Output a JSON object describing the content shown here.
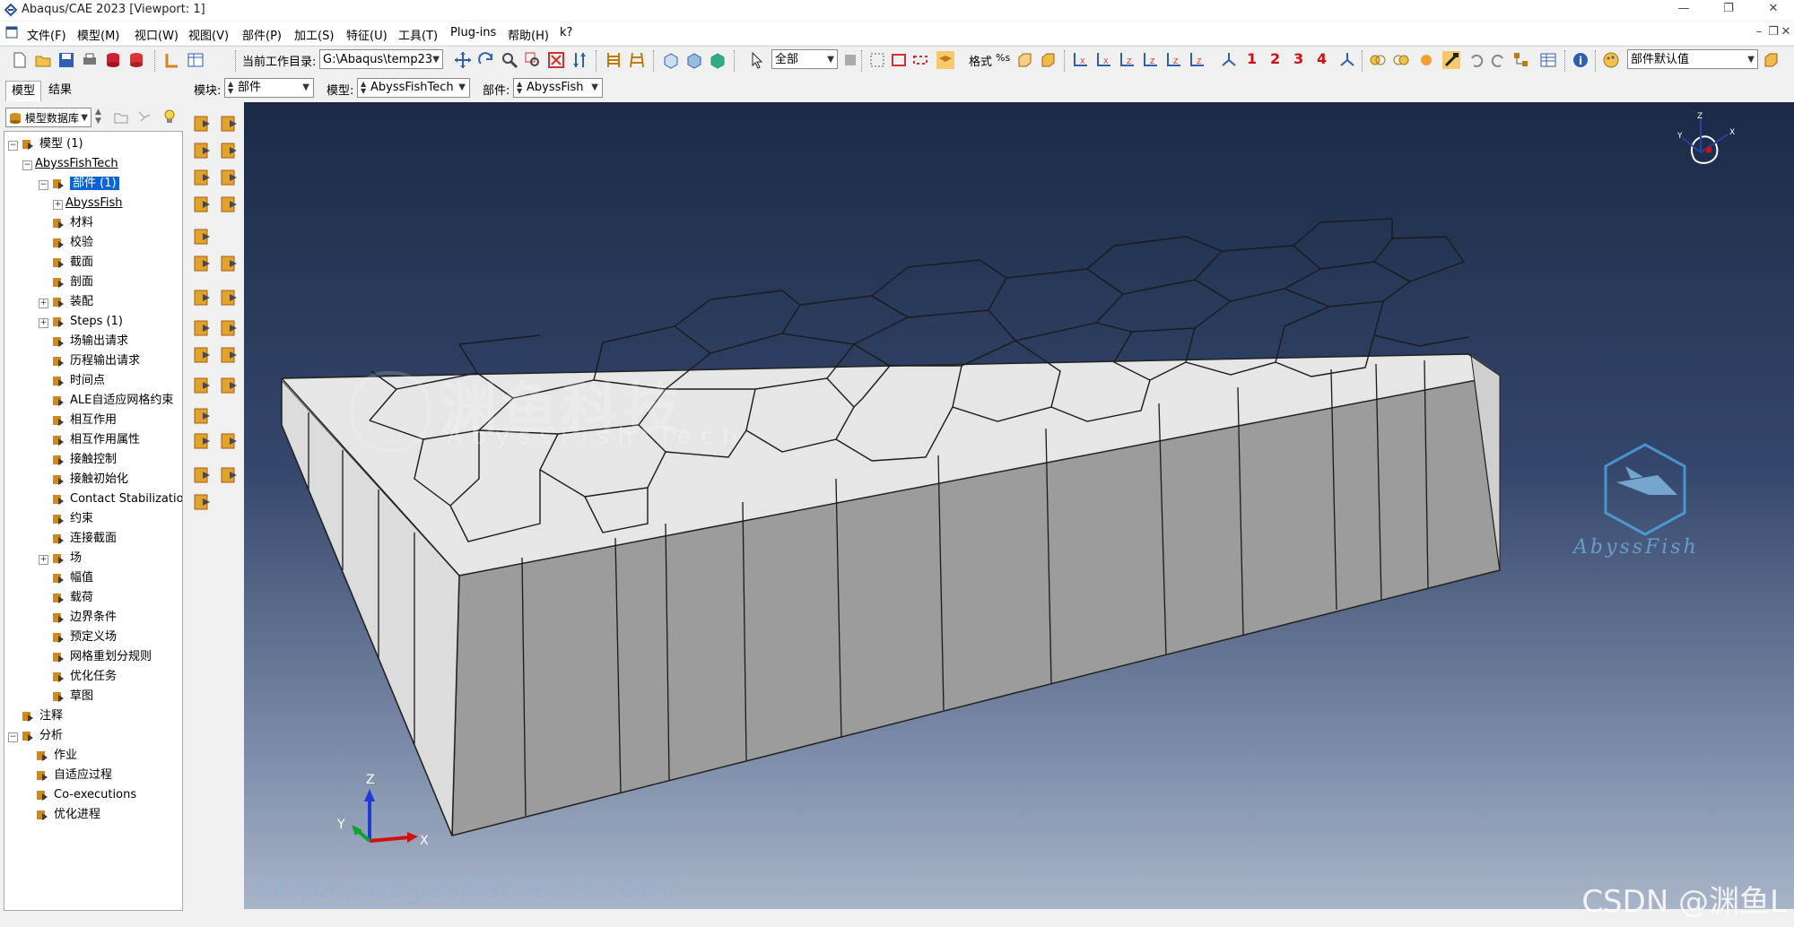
{
  "window": {
    "title": "Abaqus/CAE 2023 [Viewport: 1]"
  },
  "menubar": [
    "文件(F)",
    "模型(M)",
    "视口(W)",
    "视图(V)",
    "部件(P)",
    "加工(S)",
    "特征(U)",
    "工具(T)",
    "Plug-ins",
    "帮助(H)",
    "k?"
  ],
  "toolbar": {
    "workdir_label": "当前工作目录:",
    "workdir_value": "G:\\Abaqus\\temp23",
    "select_filter": "全部",
    "format_label": "格式",
    "datum_numbers": [
      "1",
      "2",
      "3",
      "4"
    ],
    "part_defaults": "部件默认值"
  },
  "context": {
    "module_label": "模块:",
    "module_value": "部件",
    "model_label": "模型:",
    "model_value": "AbyssFishTech",
    "part_label": "部件:",
    "part_value": "AbyssFish"
  },
  "tabs": [
    "模型",
    "结果"
  ],
  "tree": {
    "filter": "模型数据库",
    "items": [
      {
        "label": "模型 (1)",
        "icon": "model-db-icon",
        "level": 0,
        "exp": "-"
      },
      {
        "label": "AbyssFishTech",
        "icon": "",
        "level": 1,
        "exp": "-",
        "underline": true
      },
      {
        "label": "部件 (1)",
        "icon": "part-icon",
        "level": 2,
        "exp": "-",
        "selected": true
      },
      {
        "label": "AbyssFish",
        "icon": "",
        "level": 3,
        "exp": "+",
        "underline": true
      },
      {
        "label": "材料",
        "icon": "material-icon",
        "level": 2
      },
      {
        "label": "校验",
        "icon": "calibration-icon",
        "level": 2
      },
      {
        "label": "截面",
        "icon": "section-icon",
        "level": 2
      },
      {
        "label": "剖面",
        "icon": "profile-icon",
        "level": 2
      },
      {
        "label": "装配",
        "icon": "assembly-icon",
        "level": 2,
        "exp": "+"
      },
      {
        "label": "Steps (1)",
        "icon": "steps-icon",
        "level": 2,
        "exp": "+"
      },
      {
        "label": "场输出请求",
        "icon": "field-output-icon",
        "level": 2
      },
      {
        "label": "历程输出请求",
        "icon": "history-output-icon",
        "level": 2
      },
      {
        "label": "时间点",
        "icon": "time-points-icon",
        "level": 2
      },
      {
        "label": "ALE自适应网格约束",
        "icon": "ale-icon",
        "level": 2
      },
      {
        "label": "相互作用",
        "icon": "interaction-icon",
        "level": 2
      },
      {
        "label": "相互作用属性",
        "icon": "interaction-property-icon",
        "level": 2
      },
      {
        "label": "接触控制",
        "icon": "contact-control-icon",
        "level": 2
      },
      {
        "label": "接触初始化",
        "icon": "contact-init-icon",
        "level": 2
      },
      {
        "label": "Contact Stabilizations",
        "icon": "contact-stab-icon",
        "level": 2
      },
      {
        "label": "约束",
        "icon": "constraint-icon",
        "level": 2
      },
      {
        "label": "连接截面",
        "icon": "connector-section-icon",
        "level": 2
      },
      {
        "label": "场",
        "icon": "field-icon",
        "level": 2,
        "exp": "+"
      },
      {
        "label": "幅值",
        "icon": "amplitude-icon",
        "level": 2
      },
      {
        "label": "载荷",
        "icon": "load-icon",
        "level": 2
      },
      {
        "label": "边界条件",
        "icon": "bc-icon",
        "level": 2
      },
      {
        "label": "预定义场",
        "icon": "predefined-field-icon",
        "level": 2
      },
      {
        "label": "网格重划分规则",
        "icon": "remesh-icon",
        "level": 2
      },
      {
        "label": "优化任务",
        "icon": "optimization-icon",
        "level": 2
      },
      {
        "label": "草图",
        "icon": "sketch-icon",
        "level": 2
      },
      {
        "label": "注释",
        "icon": "annotation-icon",
        "level": 0,
        "exp": ""
      },
      {
        "label": "分析",
        "icon": "analysis-icon",
        "level": 0,
        "exp": "-"
      },
      {
        "label": "作业",
        "icon": "job-icon",
        "level": 1
      },
      {
        "label": "自适应过程",
        "icon": "adaptivity-icon",
        "level": 1
      },
      {
        "label": "Co-executions",
        "icon": "coexec-icon",
        "level": 1
      },
      {
        "label": "优化进程",
        "icon": "opt-process-icon",
        "level": 1
      }
    ]
  },
  "viewport": {
    "triad": {
      "x": "X",
      "y": "Y",
      "z": "Z"
    },
    "mini_triad": {
      "x": "X",
      "y": "Y",
      "z": "Z"
    }
  },
  "watermarks": {
    "cn": "渊鱼科技",
    "en": "AbyssFish Tech",
    "fish": "AbyssFish",
    "url": "https://abyssfishtech.com/",
    "csdn": "CSDN @渊鱼L"
  },
  "colors": {
    "viewport_top": "#1b2a46",
    "viewport_bottom": "#a8b4c8",
    "selection": "#0a64d8",
    "part_top": "#e4e4e4",
    "part_front": "#9c9c9c",
    "part_side": "#dcdcdc"
  }
}
